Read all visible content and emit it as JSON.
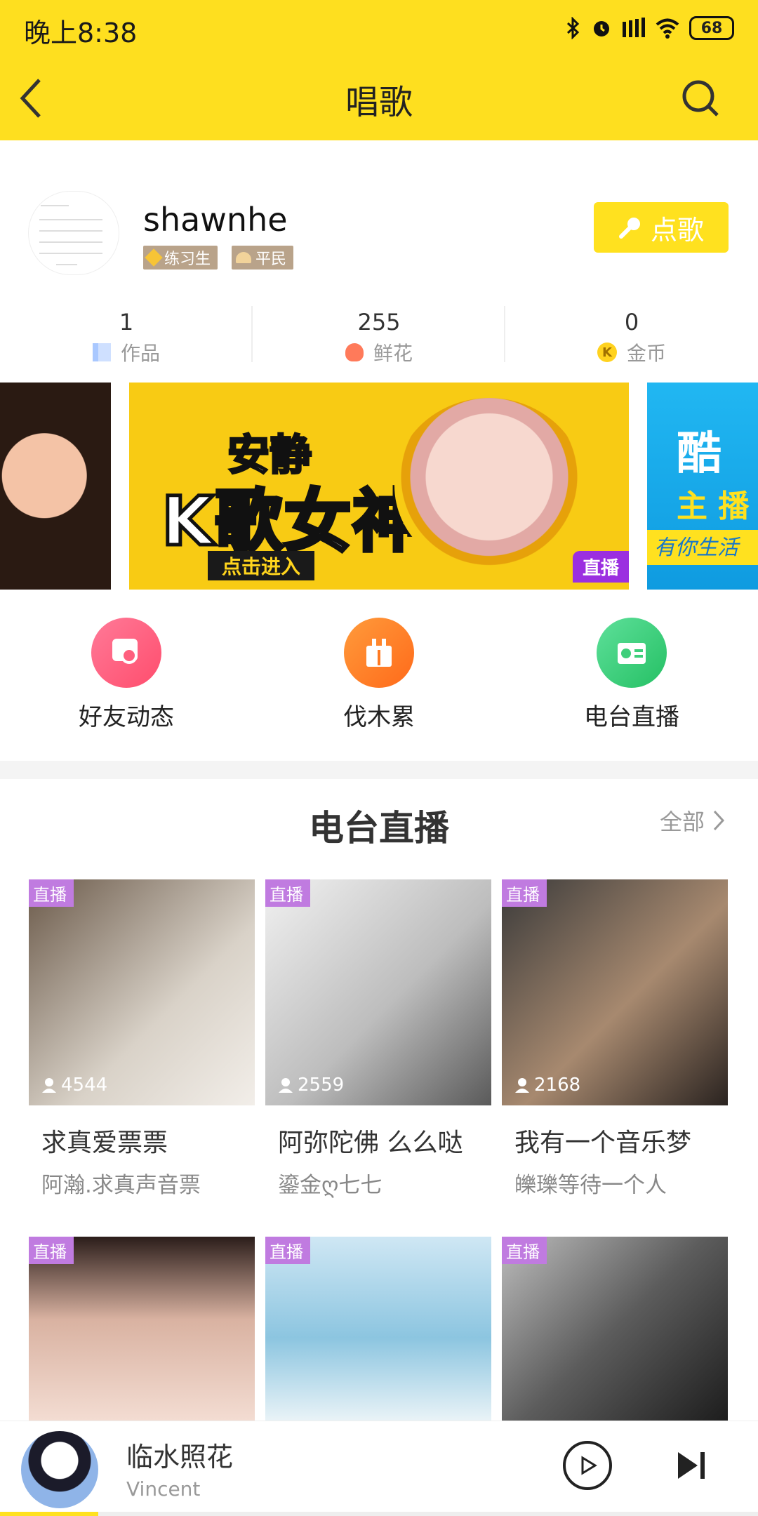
{
  "status_bar": {
    "time": "晚上8:38",
    "battery": "68",
    "icons": [
      "bluetooth-icon",
      "alarm-icon",
      "signal-icon",
      "wifi-icon",
      "battery-icon"
    ]
  },
  "header": {
    "title": "唱歌",
    "back_icon": "back-icon",
    "search_icon": "search-icon"
  },
  "profile": {
    "username": "shawnhe",
    "badges": [
      "练习生",
      "平民"
    ],
    "order_button": "点歌"
  },
  "stats": [
    {
      "value": "1",
      "label": "作品",
      "icon": "works-icon"
    },
    {
      "value": "255",
      "label": "鲜花",
      "icon": "flower-icon"
    },
    {
      "value": "0",
      "label": "金币",
      "icon": "coin-icon"
    }
  ],
  "banner": {
    "main_line1": "安静",
    "main_line2": "K歌女神",
    "cta": "点击进入",
    "live": "直播",
    "right_line1": "酷",
    "right_line2": "主 播",
    "right_line3": "有你生活"
  },
  "shortcuts": [
    {
      "label": "好友动态",
      "color": "#ff5f7e"
    },
    {
      "label": "伐木累",
      "color": "#ff7a22"
    },
    {
      "label": "电台直播",
      "color": "#3ecf7a"
    }
  ],
  "section": {
    "title": "电台直播",
    "all": "全部"
  },
  "live_cards": [
    {
      "badge": "直播",
      "viewers": "4544",
      "title": "求真爱票票",
      "host": "阿瀚.求真声音票"
    },
    {
      "badge": "直播",
      "viewers": "2559",
      "title": "阿弥陀佛 么么哒",
      "host": "鎏金ღ七七"
    },
    {
      "badge": "直播",
      "viewers": "2168",
      "title": "我有一个音乐梦",
      "host": "皪瓅等待一个人"
    },
    {
      "badge": "直播"
    },
    {
      "badge": "直播"
    },
    {
      "badge": "直播"
    }
  ],
  "player": {
    "song": "临水照花",
    "artist": "Vincent"
  },
  "colors": {
    "brand_yellow": "#fedf1f",
    "live_purple": "#c07be0"
  }
}
